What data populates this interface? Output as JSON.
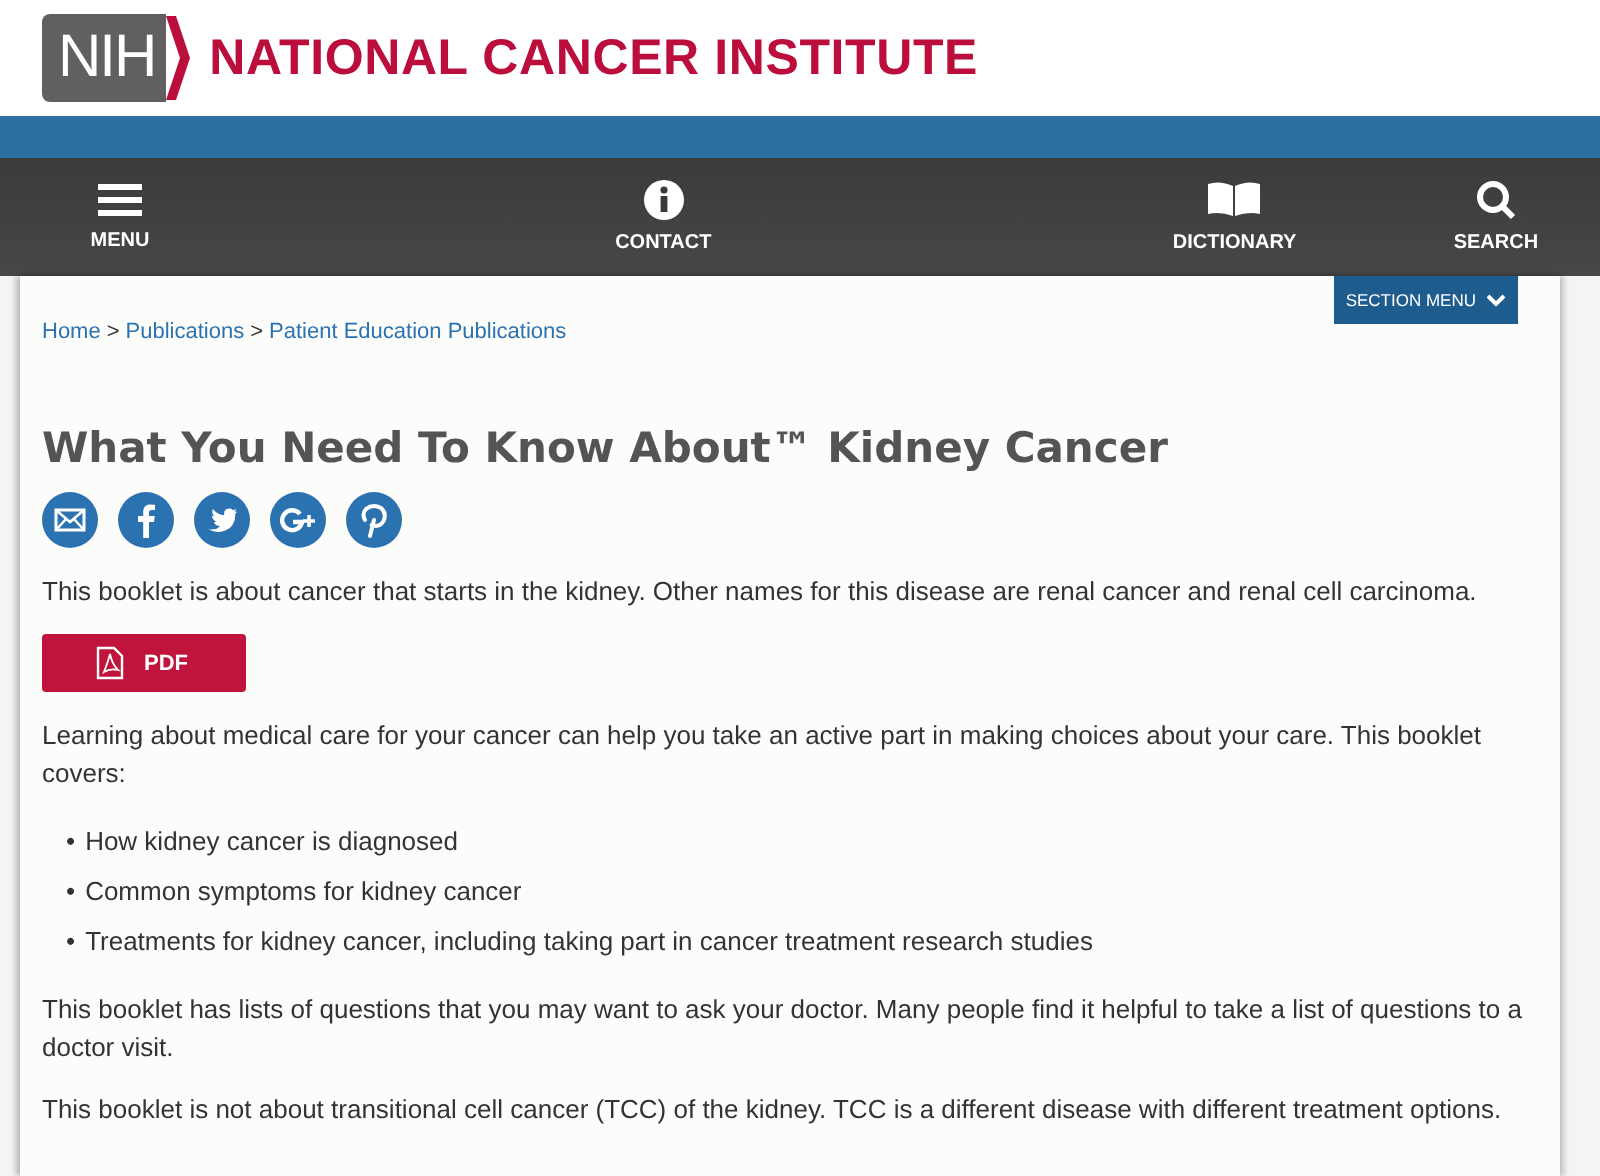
{
  "header": {
    "logo_mark": "NIH",
    "logo_text": "NATIONAL CANCER INSTITUTE"
  },
  "nav": [
    {
      "kind": "menu",
      "label": "MENU"
    },
    {
      "kind": "contact",
      "label": "CONTACT"
    },
    {
      "kind": "dictionary",
      "label": "DICTIONARY"
    },
    {
      "kind": "search",
      "label": "SEARCH"
    }
  ],
  "section_menu": "SECTION MENU",
  "breadcrumb": {
    "separator": ">",
    "items": [
      "Home",
      "Publications",
      "Patient Education Publications"
    ]
  },
  "title": "What You Need To Know About™ Kidney Cancer",
  "share": [
    {
      "kind": "email"
    },
    {
      "kind": "facebook"
    },
    {
      "kind": "twitter"
    },
    {
      "kind": "googleplus"
    },
    {
      "kind": "pinterest"
    }
  ],
  "intro": "This booklet is about cancer that starts in the kidney. Other names for this disease are renal cancer and renal cell carcinoma.",
  "pdf_button": "PDF",
  "paragraph_1": "Learning about medical care for your cancer can help you take an active part in making choices about your care. This booklet covers:",
  "bullet_marker": "•",
  "bullets": [
    "How kidney cancer is diagnosed",
    "Common symptoms for kidney cancer",
    "Treatments for kidney cancer, including taking part in cancer treatment research studies"
  ],
  "paragraph_2": "This booklet has lists of questions that you may want to ask your doctor. Many people find it helpful to take a list of questions to a doctor visit.",
  "paragraph_3": "This booklet is not about transitional cell cancer (TCC) of the kidney. TCC is a different disease with different treatment options."
}
